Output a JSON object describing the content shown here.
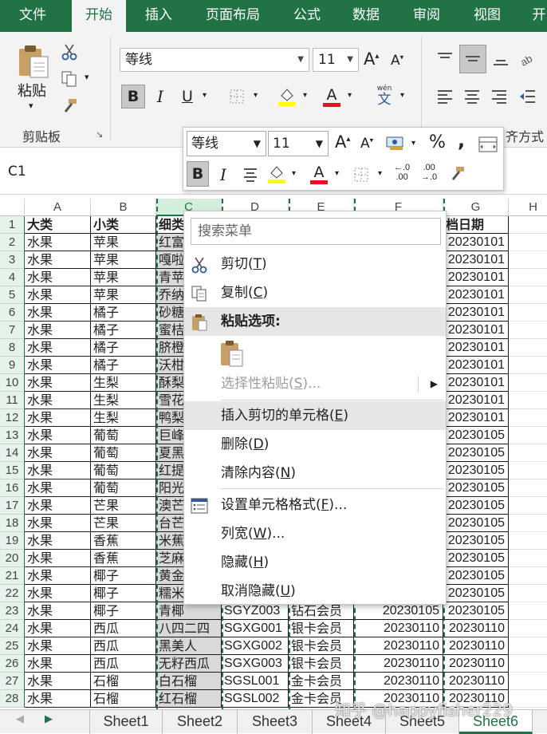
{
  "tabs": [
    "文件",
    "开始",
    "插入",
    "页面布局",
    "公式",
    "数据",
    "审阅",
    "视图",
    "开"
  ],
  "active_tab": "开始",
  "ribbon": {
    "paste_label": "粘贴",
    "clipboard_group": "剪贴板",
    "font_name": "等线",
    "font_size": "11",
    "align_group_partial": "齐方式",
    "phonetic_top": "wén",
    "phonetic_bottom": "文"
  },
  "mini_toolbar": {
    "font_name": "等线",
    "font_size": "11",
    "percent": "%",
    "comma": ",",
    "inc_decimal": ".00",
    "dec_decimal": ".00"
  },
  "name_box": "C1",
  "columns": [
    "A",
    "B",
    "C",
    "D",
    "E",
    "F",
    "G",
    "H"
  ],
  "rows": [
    [
      "大类",
      "小类",
      "细类",
      "",
      "",
      "",
      "档日期"
    ],
    [
      "水果",
      "苹果",
      "红富",
      "",
      "",
      "",
      "20230101"
    ],
    [
      "水果",
      "苹果",
      "嘎啦",
      "",
      "",
      "",
      "20230101"
    ],
    [
      "水果",
      "苹果",
      "青苹",
      "",
      "",
      "",
      "20230101"
    ],
    [
      "水果",
      "苹果",
      "乔纳",
      "",
      "",
      "",
      "20230101"
    ],
    [
      "水果",
      "橘子",
      "砂糖",
      "",
      "",
      "",
      "20230101"
    ],
    [
      "水果",
      "橘子",
      "蜜桔",
      "",
      "",
      "",
      "20230101"
    ],
    [
      "水果",
      "橘子",
      "脐橙",
      "",
      "",
      "",
      "20230101"
    ],
    [
      "水果",
      "橘子",
      "沃柑",
      "",
      "",
      "",
      "20230101"
    ],
    [
      "水果",
      "生梨",
      "酥梨",
      "",
      "",
      "",
      "20230101"
    ],
    [
      "水果",
      "生梨",
      "雪花",
      "",
      "",
      "",
      "20230101"
    ],
    [
      "水果",
      "生梨",
      "鸭梨",
      "",
      "",
      "",
      "20230101"
    ],
    [
      "水果",
      "葡萄",
      "巨峰",
      "",
      "",
      "",
      "20230105"
    ],
    [
      "水果",
      "葡萄",
      "夏黑",
      "",
      "",
      "",
      "20230105"
    ],
    [
      "水果",
      "葡萄",
      "红提",
      "",
      "",
      "",
      "20230105"
    ],
    [
      "水果",
      "葡萄",
      "阳光",
      "",
      "",
      "",
      "20230105"
    ],
    [
      "水果",
      "芒果",
      "澳芒",
      "",
      "",
      "",
      "20230105"
    ],
    [
      "水果",
      "芒果",
      "台芒",
      "",
      "",
      "",
      "20230105"
    ],
    [
      "水果",
      "香蕉",
      "米蕉",
      "",
      "",
      "",
      "20230105"
    ],
    [
      "水果",
      "香蕉",
      "芝麻",
      "",
      "",
      "",
      "20230105"
    ],
    [
      "水果",
      "椰子",
      "黄金",
      "",
      "",
      "",
      "20230105"
    ],
    [
      "水果",
      "椰子",
      "糯米",
      "",
      "",
      "",
      "20230105"
    ],
    [
      "水果",
      "椰子",
      "青椰",
      "SGYZ003",
      "钻石会员",
      "20230105",
      "20230105"
    ],
    [
      "水果",
      "西瓜",
      "八四二四",
      "SGXG001",
      "银卡会员",
      "20230110",
      "20230110"
    ],
    [
      "水果",
      "西瓜",
      "黑美人",
      "SGXG002",
      "银卡会员",
      "20230110",
      "20230110"
    ],
    [
      "水果",
      "西瓜",
      "无籽西瓜",
      "SGXG003",
      "银卡会员",
      "20230110",
      "20230110"
    ],
    [
      "水果",
      "石榴",
      "白石榴",
      "SGSL001",
      "金卡会员",
      "20230110",
      "20230110"
    ],
    [
      "水果",
      "石榴",
      "红石榴",
      "SGSL002",
      "金卡会员",
      "20230110",
      "20230110"
    ]
  ],
  "context_menu": {
    "search_placeholder": "搜索菜单",
    "cut": "剪切(",
    "cut_key": "T",
    "cut_end": ")",
    "copy": "复制(",
    "copy_key": "C",
    "copy_end": ")",
    "paste_options": "粘贴选项:",
    "paste_special": "选择性粘贴(",
    "paste_special_key": "S",
    "paste_special_end": ")...",
    "insert_cut": "插入剪切的单元格(",
    "insert_cut_key": "E",
    "insert_cut_end": ")",
    "delete": "删除(",
    "delete_key": "D",
    "delete_end": ")",
    "clear": "清除内容(",
    "clear_key": "N",
    "clear_end": ")",
    "format_cells": "设置单元格格式(",
    "format_cells_key": "F",
    "format_cells_end": ")...",
    "col_width": "列宽(",
    "col_width_key": "W",
    "col_width_end": ")...",
    "hide": "隐藏(",
    "hide_key": "H",
    "hide_end": ")",
    "unhide": "取消隐藏(",
    "unhide_key": "U",
    "unhide_end": ")"
  },
  "sheets": [
    "Sheet1",
    "Sheet2",
    "Sheet3",
    "Sheet4",
    "Sheet5",
    "Sheet6"
  ],
  "active_sheet": "Sheet6",
  "watermark": "知乎 @happyfisher229",
  "colors": {
    "excel_green": "#217346",
    "font_red": "#e81123",
    "highlight_yellow": "#ffff00"
  }
}
